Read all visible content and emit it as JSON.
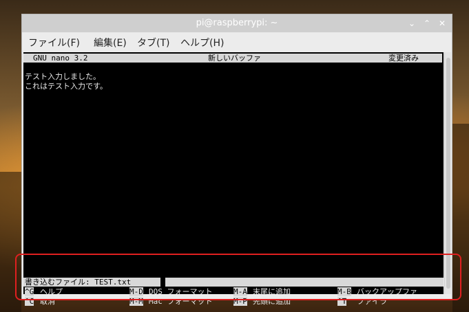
{
  "window": {
    "title": "pi@raspberrypi: ~",
    "buttons": {
      "minimize": "⌄",
      "maximize": "⌃",
      "close": "✕"
    }
  },
  "menubar": {
    "items": [
      {
        "label": "ファイル(F)"
      },
      {
        "label": "編集(E)"
      },
      {
        "label": "タブ(T)"
      },
      {
        "label": "ヘルプ(H)"
      }
    ]
  },
  "nano": {
    "version": "GNU nano 3.2",
    "buffer_name": "新しいバッファ",
    "status": "変更済み",
    "lines": [
      "テスト入力しました。",
      "これはテスト入力です。"
    ],
    "prompt_label": "書き込むファイル: TEST.txt",
    "shortcuts_row1": [
      {
        "key": "^G",
        "label": "ヘルプ"
      },
      {
        "key": "M-D",
        "label": "DOS フォーマット"
      },
      {
        "key": "M-A",
        "label": "末尾に追加"
      },
      {
        "key": "M-B",
        "label": "バックアップファ"
      }
    ],
    "shortcuts_row2": [
      {
        "key": "^C",
        "label": "取消"
      },
      {
        "key": "M-M",
        "label": "Mac フォーマット"
      },
      {
        "key": "M-P",
        "label": "先頭に追加"
      },
      {
        "key": "^T",
        "label": "ファイラ"
      }
    ]
  },
  "colors": {
    "terminal_bg": "#000000",
    "terminal_fg": "#e8e8e8",
    "highlight_box": "#e02020",
    "titlebar": "#cfcfcf"
  }
}
